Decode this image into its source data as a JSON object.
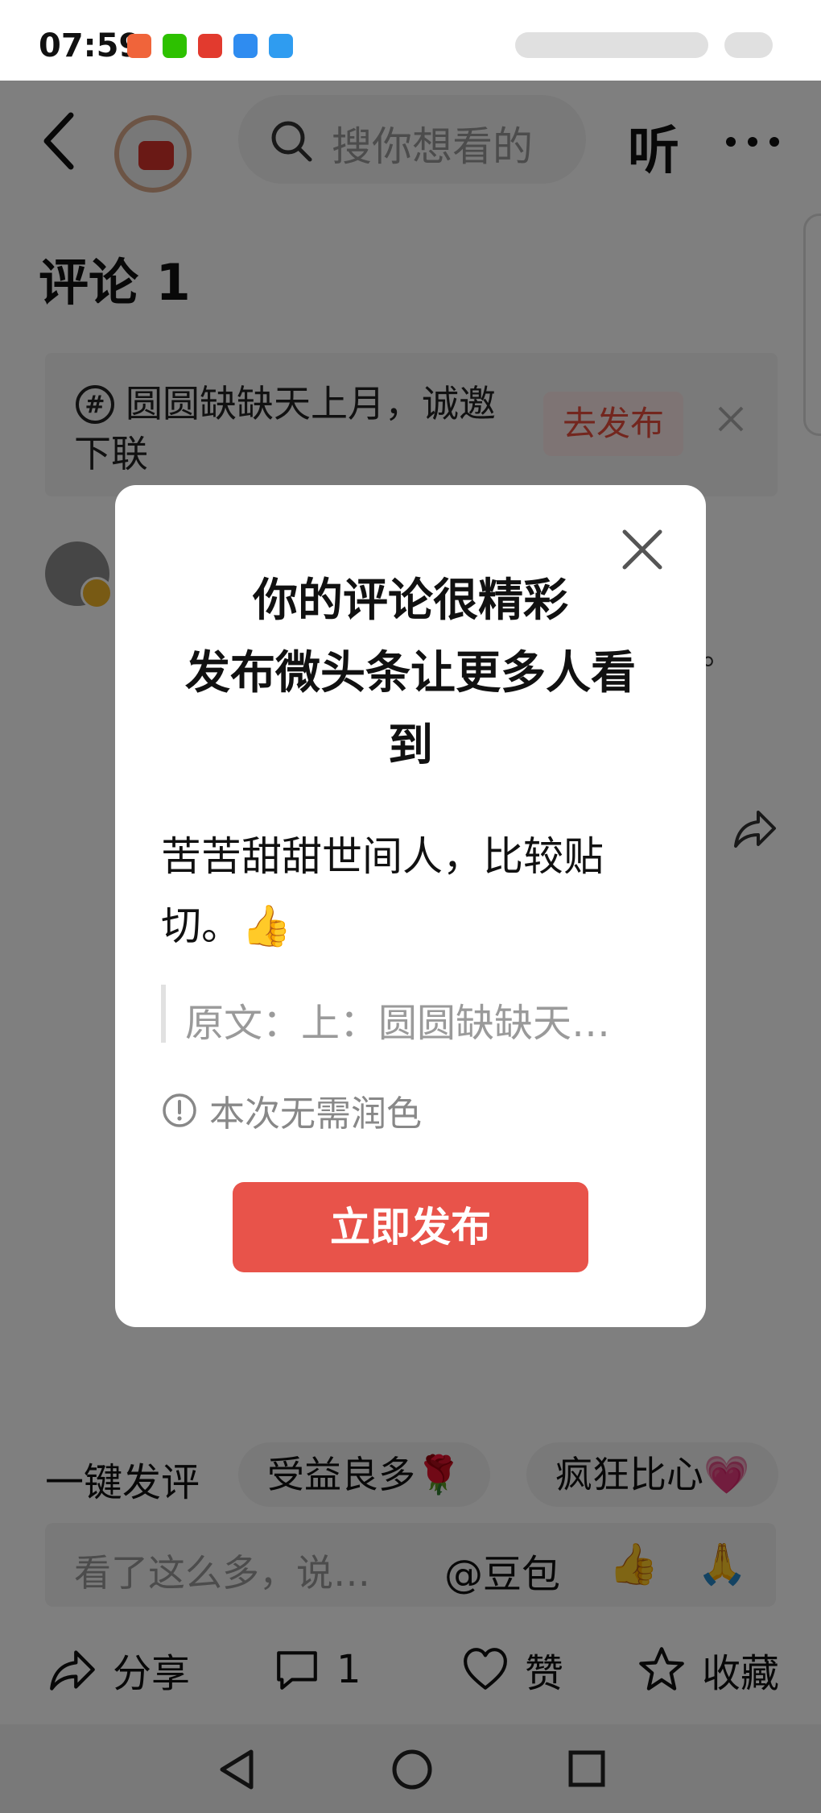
{
  "status_bar": {
    "time": "07:59"
  },
  "header": {
    "search_placeholder": "搜你想看的",
    "listen_label": "听"
  },
  "page_title": "评论 1",
  "banner": {
    "text": "圆圆缺缺天上月，诚邀下联",
    "publish_label": "去发布"
  },
  "background_comment": {
    "trailing_char": "。"
  },
  "quick_comments": {
    "label": "一键发评",
    "chips": [
      "受益良多🌹",
      "疯狂比心💗"
    ]
  },
  "input": {
    "placeholder": "看了这么多，说…",
    "mention": "@豆包",
    "emojis": [
      "👍",
      "🙏"
    ]
  },
  "bottom_bar": {
    "share": "分享",
    "comment_count": "1",
    "like": "赞",
    "favorite": "收藏"
  },
  "modal": {
    "title_line1": "你的评论很精彩",
    "title_line2": "发布微头条让更多人看",
    "title_line3": "到",
    "comment_line1": "苦苦甜甜世间人，比较贴",
    "comment_line2": "切。👍",
    "quote": "原文：上：圆圆缺缺天…",
    "tip": "本次无需润色",
    "publish_button": "立即发布"
  },
  "colors": {
    "accent": "#e8534a",
    "accent_light": "#fde9e8",
    "overlay": "rgba(0,0,0,0.5)"
  }
}
